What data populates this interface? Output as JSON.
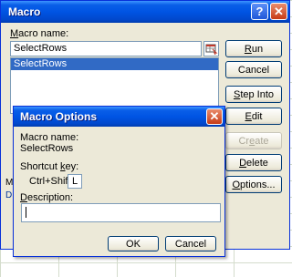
{
  "macro_dialog": {
    "title": "Macro",
    "help_glyph": "?",
    "close_glyph": "✕",
    "name_label_underlined": "M",
    "name_label_rest": "acro name:",
    "name_value": "SelectRows",
    "macros": [
      "SelectRows"
    ],
    "buttons": {
      "run": {
        "pre": "",
        "key": "R",
        "post": "un"
      },
      "cancel": {
        "pre": "Cancel",
        "key": "",
        "post": ""
      },
      "step_into": {
        "pre": "",
        "key": "S",
        "post": "tep Into"
      },
      "edit": {
        "pre": "",
        "key": "E",
        "post": "dit"
      },
      "create": {
        "pre": "Cr",
        "key": "e",
        "post": "ate"
      },
      "delete": {
        "pre": "",
        "key": "D",
        "post": "elete"
      },
      "options": {
        "pre": "",
        "key": "O",
        "post": "ptions..."
      }
    },
    "hidden_fragments": {
      "a": "M",
      "b": "D"
    }
  },
  "options_dialog": {
    "title": "Macro Options",
    "close_glyph": "✕",
    "macro_name_label": "Macro name:",
    "macro_name_value": "SelectRows",
    "shortcut_label_pre": "Shortcut ",
    "shortcut_label_key": "k",
    "shortcut_label_post": "ey:",
    "shortcut_prefix": "Ctrl+Shift+",
    "shortcut_key_value": "L",
    "description_label_key": "D",
    "description_label_rest": "escription:",
    "description_value": "",
    "ok_label": "OK",
    "cancel_label": "Cancel"
  },
  "colors": {
    "titlebar": "#0054e3",
    "dialog_face": "#ece9d8",
    "selection": "#316ac5",
    "close_button": "#c73c17"
  },
  "icons": [
    "help-icon",
    "close-icon",
    "cell-picker-icon"
  ]
}
